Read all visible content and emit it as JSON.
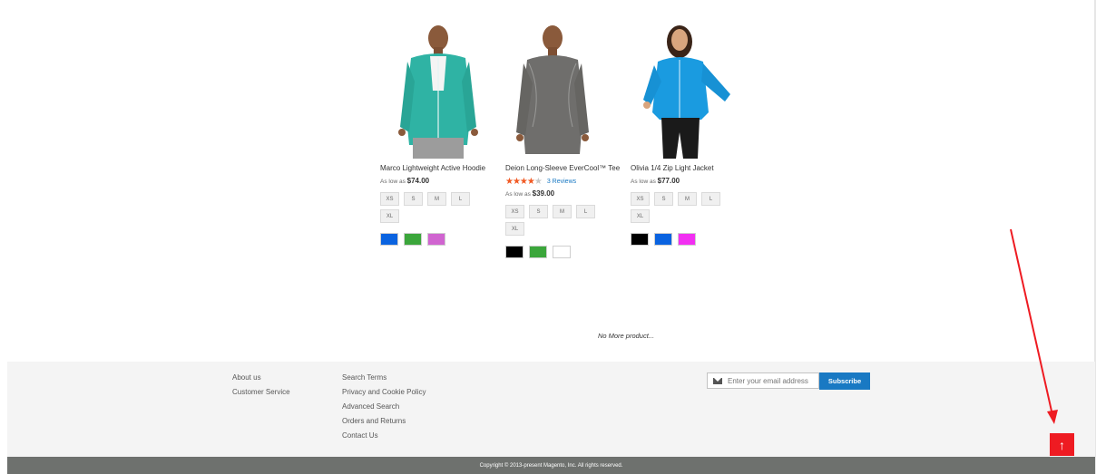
{
  "products": [
    {
      "name": "Marco Lightweight Active Hoodie",
      "price_prefix": "As low as",
      "price": "$74.00",
      "sizes": [
        "XS",
        "S",
        "M",
        "L",
        "XL"
      ],
      "swatches": [
        "#0a63e0",
        "#3ba63b",
        "#d064d0"
      ],
      "image": "man-teal-hoodie"
    },
    {
      "name": "Deion Long-Sleeve EverCool™ Tee",
      "rating": 3.5,
      "reviews": "3  Reviews",
      "price_prefix": "As low as",
      "price": "$39.00",
      "sizes": [
        "XS",
        "S",
        "M",
        "L",
        "XL"
      ],
      "swatches": [
        "#000000",
        "#3ba63b",
        "#ffffff"
      ],
      "image": "man-grey-longsleeve"
    },
    {
      "name": "Olivia 1/4 Zip Light Jacket",
      "price_prefix": "As low as",
      "price": "$77.00",
      "sizes": [
        "XS",
        "S",
        "M",
        "L",
        "XL"
      ],
      "swatches": [
        "#000000",
        "#0a63e0",
        "#f22ff2"
      ],
      "image": "woman-blue-jacket"
    }
  ],
  "no_more_text": "No More product...",
  "footer": {
    "col1": [
      "About us",
      "Customer Service"
    ],
    "col2": [
      "Search Terms",
      "Privacy and Cookie Policy",
      "Advanced Search",
      "Orders and Returns",
      "Contact Us"
    ],
    "newsletter_placeholder": "Enter your email address",
    "subscribe_label": "Subscribe",
    "copyright": "Copyright © 2013-present Magento, Inc. All rights reserved."
  },
  "back_to_top_icon": "arrow-up-icon",
  "annotation_color": "#ee1b22"
}
